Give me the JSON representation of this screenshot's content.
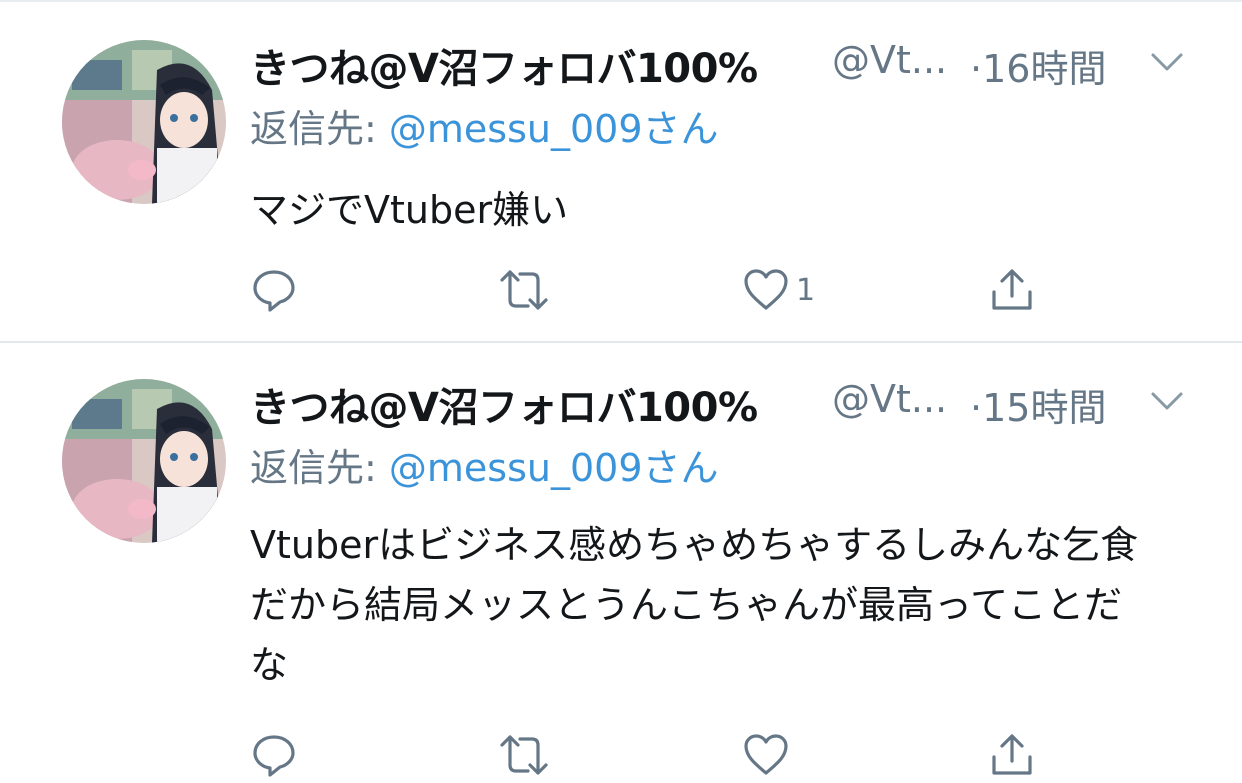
{
  "tweets": [
    {
      "display_name": "きつね@V沼フォロバ100%",
      "handle": "@Vt...",
      "separator": "·",
      "time": "16時間",
      "reply_prefix": "返信先:",
      "reply_to": "@messu_009さん",
      "text": "マジでVtuber嫌い",
      "actions": {
        "reply_count": "",
        "retweet_count": "",
        "like_count": "1"
      }
    },
    {
      "display_name": "きつね@V沼フォロバ100%",
      "handle": "@Vt...",
      "separator": "·",
      "time": "15時間",
      "reply_prefix": "返信先:",
      "reply_to": "@messu_009さん",
      "text": "Vtuberはビジネス感めちゃめちゃするしみんな乞食だから結局メッスとうんこちゃんが最高ってことだな",
      "actions": {
        "reply_count": "",
        "retweet_count": "",
        "like_count": ""
      }
    }
  ],
  "icons": {
    "avatar": "anime-avatar",
    "menu": "chevron-down-icon",
    "reply": "reply-icon",
    "retweet": "retweet-icon",
    "like": "heart-icon",
    "share": "share-icon"
  },
  "colors": {
    "text": "#14171a",
    "secondary": "#657786",
    "link": "#3b94d9",
    "divider": "#e1e8ed"
  }
}
